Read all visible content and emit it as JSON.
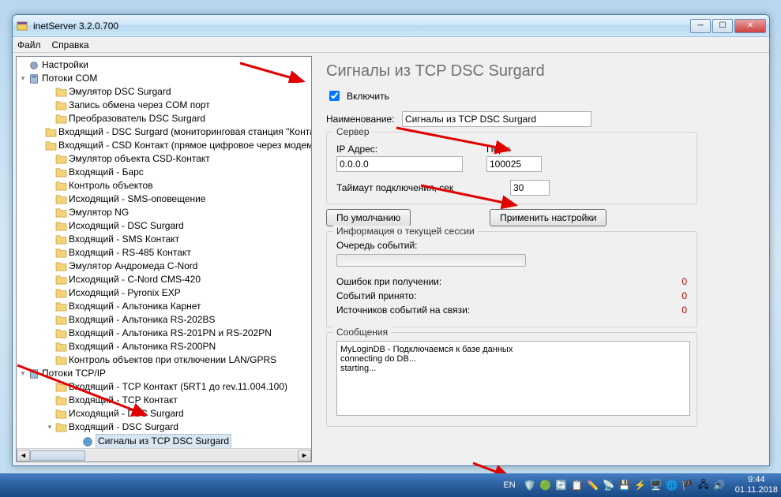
{
  "window": {
    "title": "inetServer 3.2.0.700"
  },
  "menu": {
    "file": "Файл",
    "help": "Справка"
  },
  "tree": {
    "root1": "Настройки",
    "root2": "Потоки COM",
    "com_items": [
      "Эмулятор DSC Surgard",
      "Запись обмена через COM порт",
      "Преобразователь DSC Surgard",
      "Входящий - DSC Surgard (мониторинговая станция \"Контакт\")",
      "Входящий - CSD Контакт (прямое цифровое через модем)",
      "Эмулятор объекта CSD-Контакт",
      "Входящий - Барс",
      "Контроль объектов",
      "Исходящий - SMS-оповещение",
      "Эмулятор NG",
      "Исходящий - DSC Surgard",
      "Входящий - SMS Контакт",
      "Входящий - RS-485 Контакт",
      "Эмулятор Андромеда C-Nord",
      "Исходящий - C-Nord CMS-420",
      "Исходящий - Pyronix EXP",
      "Входящий - Альтоника Карнет",
      "Входящий - Альтоника RS-202BS",
      "Входящий - Альтоника RS-201PN и RS-202PN",
      "Входящий - Альтоника RS-200PN",
      "Контроль объектов при отключении LAN/GPRS"
    ],
    "root3": "Потоки TCP/IP",
    "tcp_items": [
      "Входящий - TCP Контакт (5RT1 до rev.11.004.100)",
      "Входящий - TCP Контакт",
      "Исходящий - DSC Surgard",
      "Входящий - DSC Surgard"
    ],
    "selected": "Сигналы из TCP DSC Surgard"
  },
  "form": {
    "title": "Сигналы из TCP DSC Surgard",
    "enable": "Включить",
    "enable_checked": true,
    "name_label": "Наименование:",
    "name_value": "Сигналы из TCP DSC Surgard",
    "server_legend": "Сервер",
    "ip_label": "IP Адрес:",
    "ip_value": "0.0.0.0",
    "port_label": "Порт:",
    "port_value": "100025",
    "timeout_label": "Таймаут подключения, сек",
    "timeout_value": "30",
    "btn_default": "По умолчанию",
    "btn_apply": "Применить настройки",
    "session_legend": "Информация о текущей сессии",
    "queue_label": "Очередь событий:",
    "err_label": "Ошибок при получении:",
    "err_value": "0",
    "events_label": "Событий принято:",
    "events_value": "0",
    "sources_label": "Источников событий на связи:",
    "sources_value": "0",
    "messages_legend": "Сообщения",
    "messages_text": "MyLoginDB - Подключаемся к базе данных\nconnecting do DB...\nstarting..."
  },
  "taskbar": {
    "lang": "EN",
    "time": "9:44",
    "date": "01.11.2018"
  }
}
